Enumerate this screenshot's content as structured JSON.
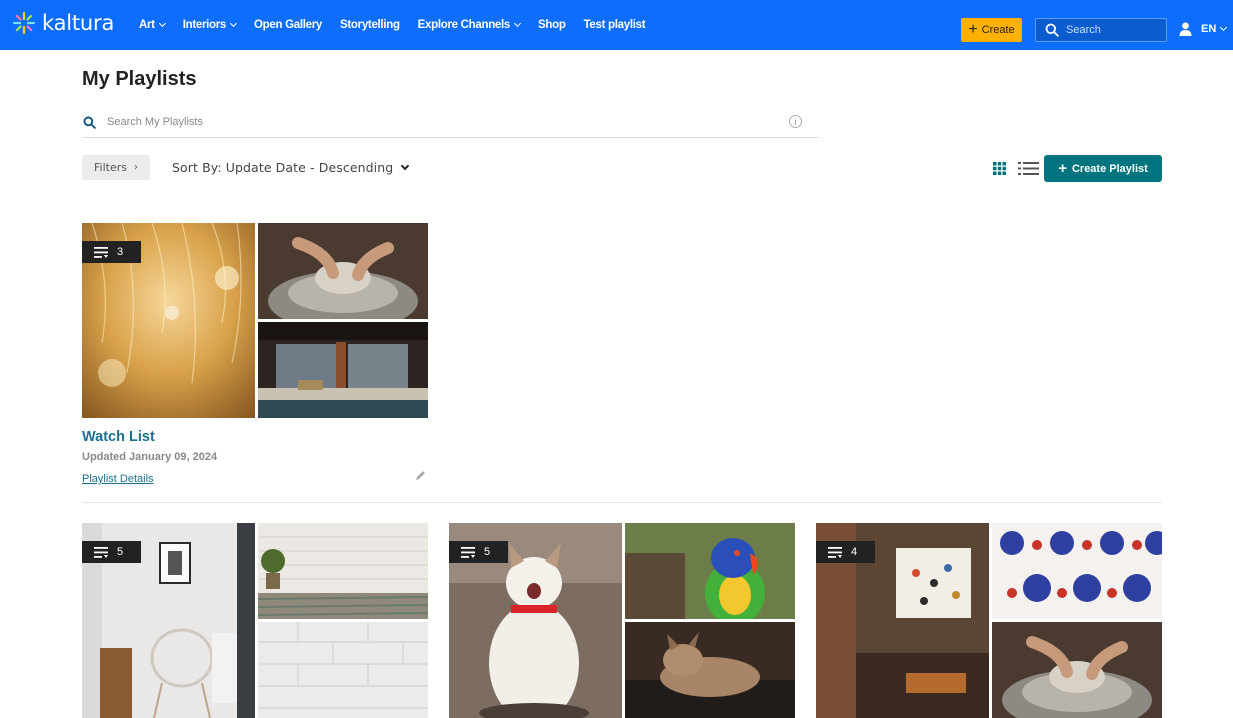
{
  "header": {
    "brand": "kaltura",
    "nav": [
      {
        "label": "Art",
        "has_dropdown": true
      },
      {
        "label": "Interiors",
        "has_dropdown": true
      },
      {
        "label": "Open Gallery",
        "has_dropdown": false
      },
      {
        "label": "Storytelling",
        "has_dropdown": false
      },
      {
        "label": "Explore Channels",
        "has_dropdown": true
      },
      {
        "label": "Shop",
        "has_dropdown": false
      },
      {
        "label": "Test playlist",
        "has_dropdown": false
      }
    ],
    "create_label": "Create",
    "search_placeholder": "Search",
    "language": "EN",
    "colors": {
      "bar": "#0d6efd",
      "create": "#ffb000"
    }
  },
  "page": {
    "title": "My Playlists",
    "search_placeholder": "Search My Playlists",
    "filters_label": "Filters",
    "sort_label": "Sort By: Update Date - Descending",
    "create_playlist_label": "Create Playlist",
    "accent": "#00757f"
  },
  "playlists": [
    {
      "count": "3",
      "title": "Watch List",
      "updated": "Updated January 09, 2024",
      "details_label": "Playlist Details"
    },
    {
      "count": "5"
    },
    {
      "count": "5"
    },
    {
      "count": "4"
    }
  ]
}
